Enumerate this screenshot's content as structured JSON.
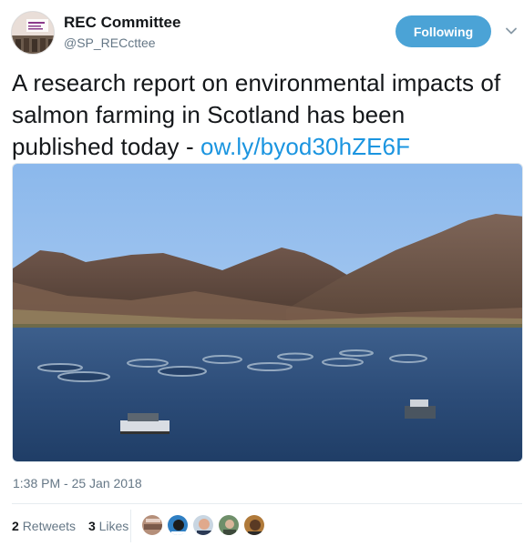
{
  "account": {
    "display_name": "REC Committee",
    "handle": "@SP_RECcttee"
  },
  "follow_button": {
    "label": "Following"
  },
  "tweet": {
    "text": "A research report on environmental impacts of salmon farming in Scotland has been published today - ",
    "link": "ow.ly/byod30hZE6F"
  },
  "timestamp": "1:38 PM - 25 Jan 2018",
  "stats": {
    "retweets_count": "2",
    "retweets_label": "Retweets",
    "likes_count": "3",
    "likes_label": "Likes"
  },
  "colors": {
    "follow_button": "#4ba3d6",
    "link": "#1b95e0",
    "secondary_text": "#657786"
  },
  "icons": [
    "chevron-down-icon"
  ]
}
